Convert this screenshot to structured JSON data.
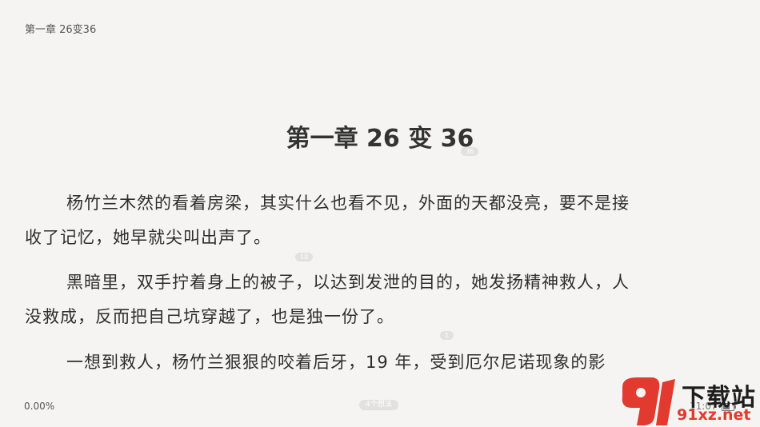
{
  "header": {
    "running_title": "第一章 26变36"
  },
  "chapter": {
    "title": "第一章 26 变 36",
    "title_comment_count": "36"
  },
  "paragraphs": [
    {
      "line1": "杨竹兰木然的看着房梁，其实什么也看不见，外面的天都没亮，要不是接",
      "line2": "收了记忆，她早就尖叫出声了。",
      "comment_count": "10"
    },
    {
      "line1": "黑暗里，双手拧着身上的被子，以达到发泄的目的，她发扬精神救人，人",
      "line2": "没救成，反而把自己坑穿越了，也是独一份了。",
      "comment_count": "1"
    },
    {
      "line1": "一想到救人，杨竹兰狠狠的咬着后牙，19 年，受到厄尔尼诺现象的影"
    }
  ],
  "footer": {
    "progress": "0.00%",
    "comments_label": "4个想法",
    "time": "11:07"
  },
  "watermark": {
    "top": "下载站",
    "bottom": "91xz.net"
  },
  "colors": {
    "background": "#f5f4f2",
    "pill": "#e2e1df",
    "watermark_red": "#e23a2e"
  }
}
